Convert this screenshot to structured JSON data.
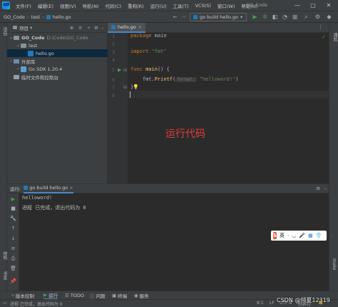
{
  "titlebar": {
    "logo": "GO",
    "menu": [
      "文件(F)",
      "编辑(E)",
      "视图(V)",
      "导航(N)",
      "代码(C)",
      "重构(R)",
      "运行(U)",
      "工具(T)",
      "VCS(S)",
      "窗口(W)",
      "帮助(H)"
    ],
    "project_title": "GO_Code",
    "controls": [
      "—",
      "▢",
      "✕"
    ]
  },
  "navbar": {
    "project": "GO_Code",
    "folder": "test",
    "file": "hello.go",
    "run_config": "go build hello.go",
    "run_config_arrow": "▾"
  },
  "left_stripe": {
    "project": "项目",
    "structure": "结构",
    "bookmarks": "书签"
  },
  "project_panel": {
    "header": "项目",
    "tree": [
      {
        "label": "GO_Code",
        "hint": "D:\\Code\\GO_Code",
        "arrow": "⌄"
      },
      {
        "label": "test",
        "hint": "",
        "arrow": "⌄"
      },
      {
        "label": "hello.go",
        "hint": "",
        "arrow": ""
      },
      {
        "label": "外部库",
        "hint": "",
        "arrow": "›"
      },
      {
        "label": "Go SDK 1.20.4",
        "hint": "",
        "arrow": "›"
      },
      {
        "label": "临时文件和控制台",
        "hint": "",
        "arrow": ""
      }
    ]
  },
  "editor": {
    "tab_label": "hello.go",
    "tab_close": "×",
    "line_numbers": [
      "1",
      "2",
      "3",
      "4",
      "5",
      "6",
      "7",
      "8"
    ],
    "code": {
      "l1_kw": "package",
      "l1_rest": " main",
      "l3_kw": "import",
      "l3_str": "\"fmt\"",
      "l5_kw": "func",
      "l5_fn": "main",
      "l5_rest": "() {",
      "l6_pre": "    fmt.",
      "l6_fn": "Printf",
      "l6_open": "(",
      "l6_hint": "format:",
      "l6_str": "\"helloword!\"",
      "l6_close": ")",
      "l7": "}"
    },
    "annotation": "运行代码"
  },
  "right_stripe": {
    "notifications": "通知",
    "make": "make"
  },
  "run_panel": {
    "tab_prefix": "运行:",
    "tab_label": "go build hello.go",
    "output": [
      "helloword!",
      "进程 已完成，退出代码为 0"
    ]
  },
  "ime": {
    "logo": "S",
    "lang": "英",
    "icons": [
      "·",
      "◡",
      "🎤",
      "▦",
      "👕",
      "⋮⋮"
    ]
  },
  "bottom_bar": {
    "items": [
      "版本控制",
      "运行",
      "TODO",
      "问题",
      "终端",
      "服务"
    ]
  },
  "status_bar": {
    "message": "进程 已完成，退出代码为 0",
    "caret_position": "8:1",
    "line_separator": "LF",
    "encoding": "UTF-8",
    "indent": "制表符"
  },
  "watermark": "CSDN @倾夏12319",
  "colors": {
    "accent": "#4a88c7",
    "run_green": "#499c54",
    "annotation_red": "#e63c3c"
  }
}
